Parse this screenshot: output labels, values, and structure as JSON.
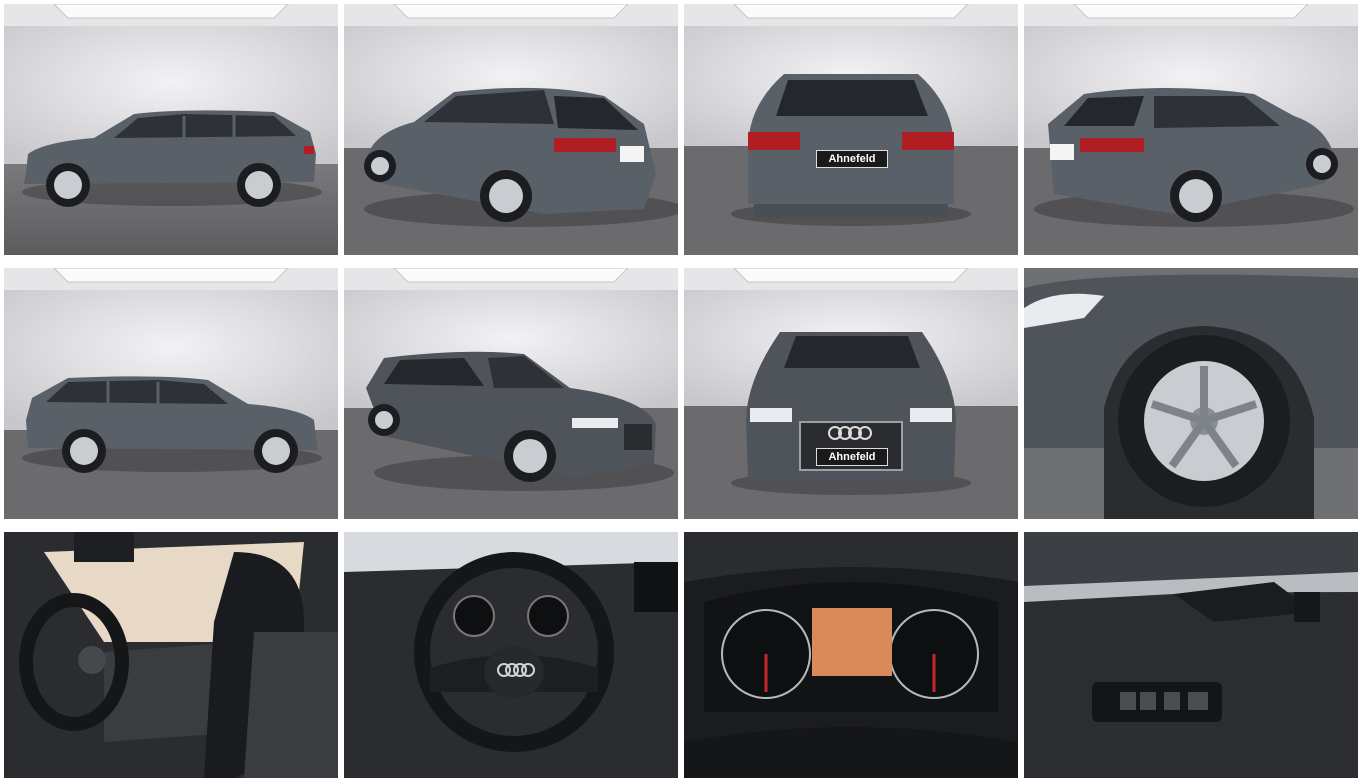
{
  "gallery": {
    "dealer_plate": "Ahnefeld",
    "rear_badge": "Ahnefeld",
    "colors": {
      "car_body": "#5a6068",
      "car_dark": "#3c4148",
      "studio_wall": "#d9d9dc",
      "studio_floor": "#6b6b6e",
      "tail_light": "#b01d22",
      "interior": "#2a2c30"
    },
    "tiles": [
      {
        "view": "side-left"
      },
      {
        "view": "rear-three-quarter-left"
      },
      {
        "view": "rear"
      },
      {
        "view": "rear-three-quarter-right"
      },
      {
        "view": "side-right"
      },
      {
        "view": "front-three-quarter-left"
      },
      {
        "view": "front"
      },
      {
        "view": "wheel-detail"
      },
      {
        "view": "interior-driver"
      },
      {
        "view": "steering-wheel"
      },
      {
        "view": "instrument-cluster"
      },
      {
        "view": "door-panel"
      }
    ]
  }
}
